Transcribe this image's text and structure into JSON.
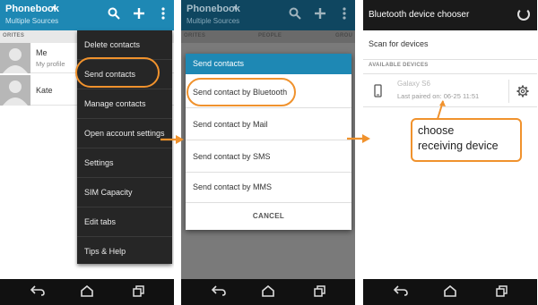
{
  "phone1": {
    "app_title": "Phonebook",
    "app_subtitle": "Multiple Sources",
    "tab_partial": "ORITES",
    "contacts": [
      {
        "name": "Me",
        "sub": "My profile"
      },
      {
        "name": "Kate",
        "sub": ""
      }
    ],
    "menu": [
      "Delete contacts",
      "Send contacts",
      "Manage contacts",
      "Open account settings",
      "Settings",
      "SIM Capacity",
      "Edit tabs",
      "Tips & Help"
    ],
    "icons": {
      "search": "search-icon",
      "add": "plus-icon",
      "overflow": "overflow-menu-icon"
    }
  },
  "phone2": {
    "app_title": "Phonebook",
    "app_subtitle": "Multiple Sources",
    "tabs": [
      "ORITES",
      "PEOPLE",
      "GROU"
    ],
    "dialog": {
      "title": "Send contacts",
      "options": [
        "Send contact by Bluetooth",
        "Send contact by Mail",
        "Send contact by SMS",
        "Send contact by MMS"
      ],
      "cancel": "CANCEL"
    }
  },
  "phone3": {
    "title": "Bluetooth device chooser",
    "scan": "Scan for devices",
    "section": "AVAILABLE DEVICES",
    "device": {
      "name": "Galaxy S6",
      "last_paired": "Last paired on: 06-25 11:51"
    }
  },
  "callout": {
    "line1": "choose",
    "line2": "receiving device"
  },
  "colors": {
    "accent": "#1e88b4",
    "highlight": "#f0922d",
    "menu_bg": "#262626",
    "nav_bg": "#111111"
  }
}
